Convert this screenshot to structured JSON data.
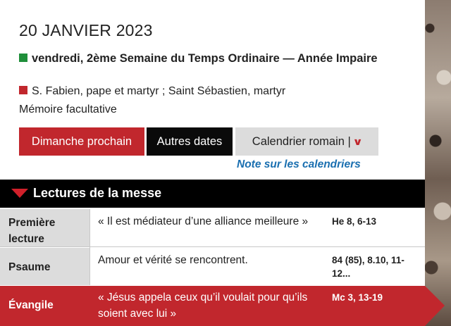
{
  "header": {
    "date": "20 JANVIER 2023",
    "feast": "vendredi, 2ème Semaine du Temps Ordinaire — Année Impaire",
    "saints": "S. Fabien, pape et martyr ; Saint Sébastien, martyr",
    "rank": "Mémoire facultative",
    "liturgical_color": "#1f8f3a",
    "saint_color": "#c1272d"
  },
  "buttons": {
    "next_sunday": "Dimanche prochain",
    "other_dates": "Autres dates",
    "calendar": "Calendrier romain |",
    "calendar_icon": "chevron-down-icon"
  },
  "note_link": "Note sur les calendriers",
  "section": {
    "title": "Lectures de la messe",
    "icon": "triangle-down-icon"
  },
  "readings": [
    {
      "title": "Première lecture",
      "text": "« Il est médiateur d’une alliance meilleure »",
      "ref": "He 8, 6-13"
    },
    {
      "title": "Psaume",
      "text": "Amour et vérité se rencontrent.",
      "ref": "84 (85), 8.10, 11-12..."
    },
    {
      "title": "Évangile",
      "text": "« Jésus appela ceux qu’il voulait pour qu’ils soient avec lui »",
      "ref": "Mc 3, 13-19"
    }
  ]
}
